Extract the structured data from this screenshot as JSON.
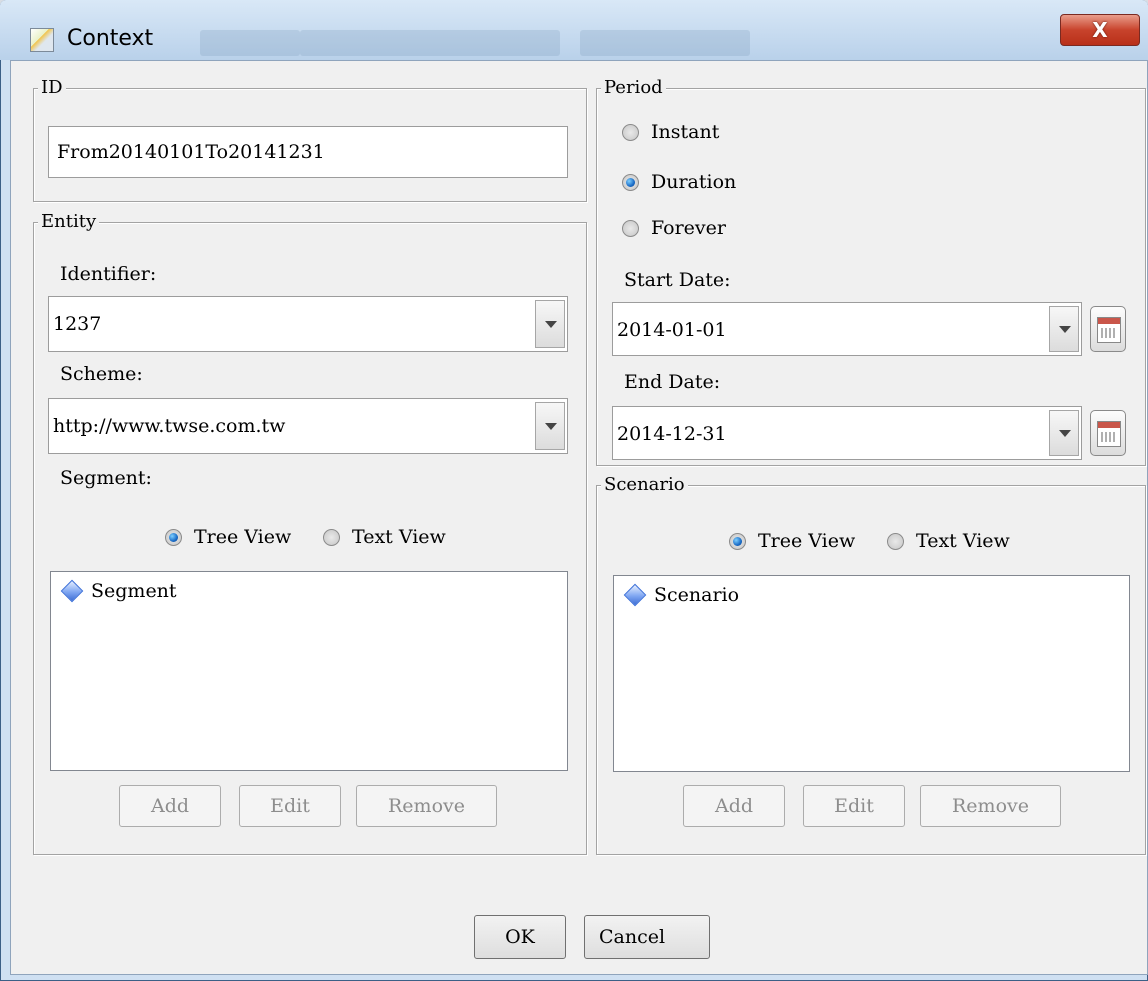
{
  "window": {
    "title": "Context",
    "close_label": "X"
  },
  "id_group": {
    "legend": "ID",
    "value": "From20140101To20141231"
  },
  "entity": {
    "legend": "Entity",
    "identifier_label": "Identifier:",
    "identifier_value": "1237",
    "scheme_label": "Scheme:",
    "scheme_value": "http://www.twse.com.tw",
    "segment_label": "Segment:",
    "view_options": [
      {
        "label": "Tree View",
        "selected": true
      },
      {
        "label": "Text View",
        "selected": false
      }
    ],
    "tree_root": "Segment",
    "buttons": {
      "add": "Add",
      "edit": "Edit",
      "remove": "Remove"
    }
  },
  "period": {
    "legend": "Period",
    "options": [
      {
        "label": "Instant",
        "selected": false
      },
      {
        "label": "Duration",
        "selected": true
      },
      {
        "label": "Forever",
        "selected": false
      }
    ],
    "start_label": "Start Date:",
    "start_value": "2014-01-01",
    "end_label": "End Date:",
    "end_value": "2014-12-31"
  },
  "scenario": {
    "legend": "Scenario",
    "view_options": [
      {
        "label": "Tree View",
        "selected": true
      },
      {
        "label": "Text View",
        "selected": false
      }
    ],
    "tree_root": "Scenario",
    "buttons": {
      "add": "Add",
      "edit": "Edit",
      "remove": "Remove"
    }
  },
  "footer": {
    "ok": "OK",
    "cancel": "Cancel"
  },
  "colors": {
    "selected_radio": "#1a6cc7",
    "close_button": "#c8432c"
  }
}
